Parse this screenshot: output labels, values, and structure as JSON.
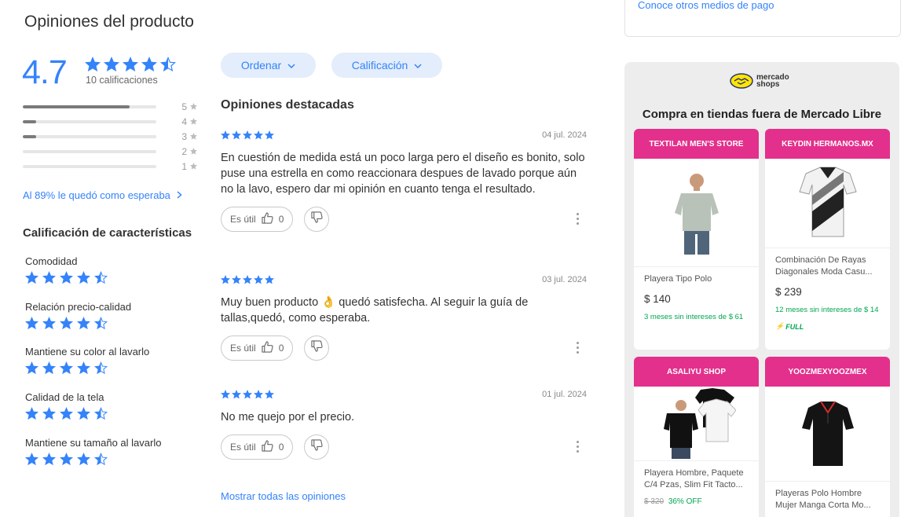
{
  "title": "Opiniones del producto",
  "summary": {
    "average": "4.7",
    "count": "10 calificaciones",
    "distribution": [
      {
        "label": "5",
        "fraction": 0.8
      },
      {
        "label": "4",
        "fraction": 0.1
      },
      {
        "label": "3",
        "fraction": 0.1
      },
      {
        "label": "2",
        "fraction": 0
      },
      {
        "label": "1",
        "fraction": 0
      }
    ],
    "expected_link": "Al 89% le quedó como esperaba"
  },
  "features": {
    "title": "Calificación de características",
    "items": [
      {
        "label": "Comodidad",
        "rating": 4.5
      },
      {
        "label": "Relación precio-calidad",
        "rating": 4.5
      },
      {
        "label": "Mantiene su color al lavarlo",
        "rating": 4.5
      },
      {
        "label": "Calidad de la tela",
        "rating": 4.5
      },
      {
        "label": "Mantiene su tamaño al lavarlo",
        "rating": 4.5
      }
    ]
  },
  "filters": {
    "sort_label": "Ordenar",
    "rating_label": "Calificación"
  },
  "reviews_section": {
    "title": "Opiniones destacadas",
    "show_all": "Mostrar todas las opiniones",
    "useful_label": "Es útil",
    "items": [
      {
        "stars": 5,
        "date": "04 jul. 2024",
        "text": "En cuestión de medida está un poco larga pero el diseño es bonito, solo puse una estrella en como reaccionara despues de lavado porque aún no la lavo, espero dar mi opinión en cuanto tenga el resultado.",
        "useful_count": "0"
      },
      {
        "stars": 5,
        "date": "03 jul. 2024",
        "text": "Muy buen producto 👌 quedó satisfecha. Al seguir la guía de tallas,quedó, como esperaba.",
        "useful_count": "0"
      },
      {
        "stars": 5,
        "date": "01 jul. 2024",
        "text": "No me quejo por el precio.",
        "useful_count": "0"
      }
    ]
  },
  "payment": {
    "link": "Conoce otros medios de pago"
  },
  "shops": {
    "logo_line1": "mercado",
    "logo_line2": "shops",
    "title": "Compra en tiendas fuera de Mercado Libre",
    "stores": [
      {
        "store": "TEXTILAN MEN'S STORE",
        "product": "Playera Tipo Polo",
        "price": "$ 140",
        "installments": "3 meses sin intereses de $ 61",
        "image": "grey-polo-model"
      },
      {
        "store": "KEYDIN HERMANOS.MX",
        "product": "Combinación De Rayas Diagonales Moda Casu...",
        "price": "$ 239",
        "installments": "12 meses sin intereses de $ 14",
        "badge": "FULL",
        "image": "striped-polo"
      },
      {
        "store": "ASALIYU SHOP",
        "product": "Playera Hombre, Paquete C/4 Pzas, Slim Fit Tacto...",
        "old_price": "$ 320",
        "discount": "36% OFF",
        "image": "tshirt-pack"
      },
      {
        "store": "YOOZMEXYOOZMEX",
        "product": "Playeras Polo Hombre Mujer Manga Corta Mo...",
        "image": "black-polo"
      }
    ]
  },
  "colors": {
    "accent": "#3483fa",
    "pill_bg": "#e3edfb",
    "shop_header": "#e3308c",
    "green": "#00a650"
  }
}
